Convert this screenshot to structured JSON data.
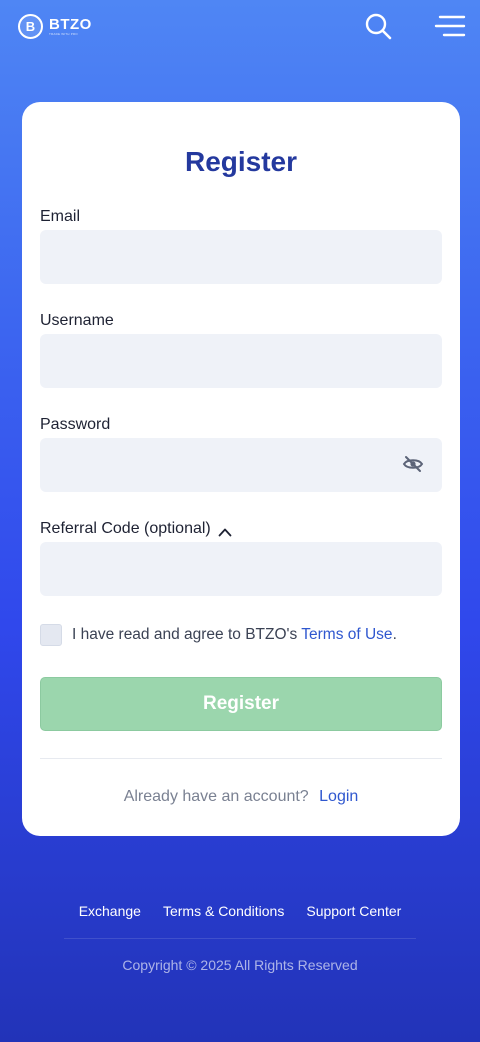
{
  "header": {
    "logo_letter": "B",
    "brand_name": "BTZO",
    "brand_tagline": "TRADE WITH PRO",
    "search_icon": "search-icon",
    "menu_icon": "hamburger-menu-icon"
  },
  "form": {
    "title": "Register",
    "email_label": "Email",
    "email_value": "",
    "username_label": "Username",
    "username_value": "",
    "password_label": "Password",
    "password_value": "",
    "password_toggle_icon": "eye-off-icon",
    "referral_label": "Referral Code (optional)",
    "referral_toggle_icon": "chevron-up-icon",
    "referral_value": "",
    "terms_text": "I have read and agree to BTZO's",
    "terms_link": "Terms of Use",
    "terms_dot": ".",
    "terms_checked": false,
    "register_button": "Register",
    "login_question": "Already have an account?",
    "login_link": "Login"
  },
  "footer": {
    "links": [
      "Exchange",
      "Terms & Conditions",
      "Support Center"
    ],
    "copyright": "Copyright © 2025 All Rights Reserved"
  },
  "colors": {
    "accent": "#24399e",
    "link": "#2f57cf",
    "register_button_disabled": "#9bd6ad",
    "background_top": "#4f86f4",
    "background_bottom": "#2233b8"
  }
}
